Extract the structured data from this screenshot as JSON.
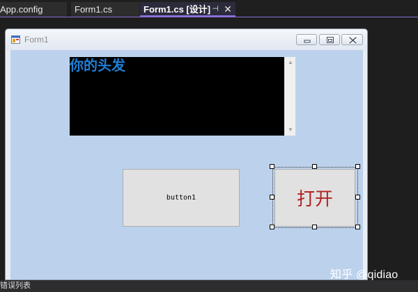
{
  "tabs": [
    {
      "label": "App.config"
    },
    {
      "label": "Form1.cs"
    },
    {
      "label": "Form1.cs [设计]",
      "pin_glyph": "⊣",
      "close_glyph": "✕"
    }
  ],
  "form": {
    "title": "Form1",
    "icon": "form-app-icon",
    "caption_buttons": [
      "minimize-icon",
      "maximize-icon",
      "close-icon"
    ]
  },
  "textbox": {
    "text": "你的头发",
    "scroll_up": "▲",
    "scroll_down": "▼"
  },
  "buttons": {
    "button1": "button1",
    "open": "打开"
  },
  "status": {
    "text": "错误列表"
  },
  "watermark": "知乎 @qidiao",
  "colors": {
    "form_client": "#bcd2ec",
    "textbox_bg": "#000000",
    "textbox_fg": "#1e7fd6",
    "open_button_fg": "#b42222",
    "accent": "#8a6fd8"
  }
}
